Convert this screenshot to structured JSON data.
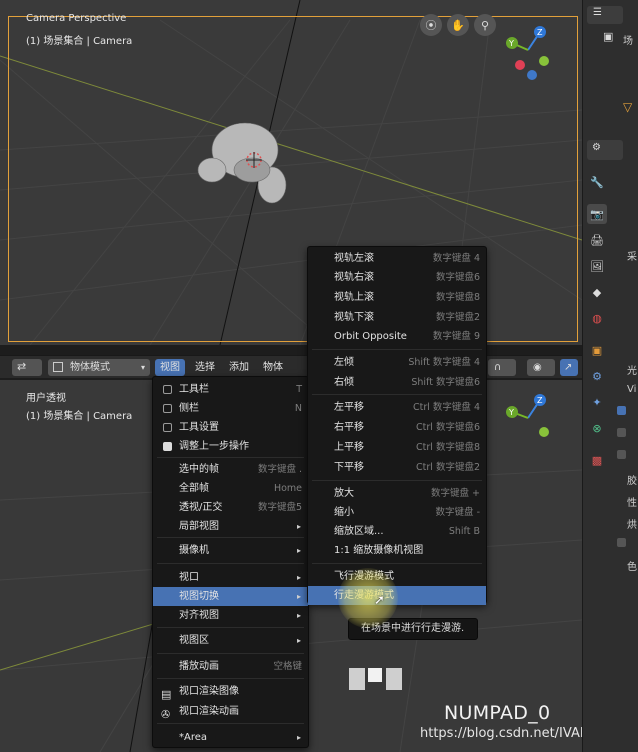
{
  "top_viewport": {
    "title": "Camera Perspective",
    "subtitle": "(1) 场景集合 | Camera",
    "gizmo": {
      "z": "Z",
      "y": "Y",
      "x": "X"
    }
  },
  "bottom_viewport": {
    "title": "用户透视",
    "subtitle": "(1) 场景集合 | Camera",
    "gizmo": {
      "z": "Z",
      "y": "Y"
    }
  },
  "header": {
    "mode": "物体模式",
    "menus": [
      "视图",
      "选择",
      "添加",
      "物体"
    ]
  },
  "view_menu": {
    "items": [
      {
        "label": "工具栏",
        "shortcut": "T",
        "type": "check",
        "checked": false
      },
      {
        "label": "侧栏",
        "shortcut": "N",
        "type": "check",
        "checked": false
      },
      {
        "label": "工具设置",
        "shortcut": "",
        "type": "check",
        "checked": false
      },
      {
        "label": "调整上一步操作",
        "shortcut": "",
        "type": "check",
        "checked": true
      },
      {
        "label": "选中的帧",
        "shortcut": "数字键盘 .",
        "type": "plain"
      },
      {
        "label": "全部帧",
        "shortcut": "Home",
        "type": "plain"
      },
      {
        "label": "透视/正交",
        "shortcut": "数字键盘5",
        "type": "plain"
      },
      {
        "label": "局部视图",
        "shortcut": "",
        "type": "submenu"
      },
      {
        "label": "摄像机",
        "shortcut": "",
        "type": "submenu"
      },
      {
        "label": "视口",
        "shortcut": "",
        "type": "submenu"
      },
      {
        "label": "视图切换",
        "shortcut": "",
        "type": "submenu",
        "highlighted": true
      },
      {
        "label": "对齐视图",
        "shortcut": "",
        "type": "submenu"
      },
      {
        "label": "视图区",
        "shortcut": "",
        "type": "submenu"
      },
      {
        "label": "播放动画",
        "shortcut": "空格键",
        "type": "plain"
      },
      {
        "label": "视口渲染图像",
        "shortcut": "",
        "type": "icon",
        "icon": "render-image-icon"
      },
      {
        "label": "视口渲染动画",
        "shortcut": "",
        "type": "icon",
        "icon": "render-animation-icon"
      },
      {
        "label": "*Area",
        "shortcut": "",
        "type": "submenu"
      }
    ]
  },
  "navigation_submenu": {
    "items": [
      {
        "label": "视轨左滚",
        "shortcut": "数字键盘 4"
      },
      {
        "label": "视轨右滚",
        "shortcut": "数字键盘6"
      },
      {
        "label": "视轨上滚",
        "shortcut": "数字键盘8"
      },
      {
        "label": "视轨下滚",
        "shortcut": "数字键盘2"
      },
      {
        "label": "Orbit Opposite",
        "shortcut": "数字键盘 9"
      },
      {
        "label": "左倾",
        "shortcut": "Shift 数字键盘 4"
      },
      {
        "label": "右倾",
        "shortcut": "Shift 数字键盘6"
      },
      {
        "label": "左平移",
        "shortcut": "Ctrl 数字键盘 4"
      },
      {
        "label": "右平移",
        "shortcut": "Ctrl 数字键盘6"
      },
      {
        "label": "上平移",
        "shortcut": "Ctrl 数字键盘8"
      },
      {
        "label": "下平移",
        "shortcut": "Ctrl 数字键盘2"
      },
      {
        "label": "放大",
        "shortcut": "数字键盘 +"
      },
      {
        "label": "缩小",
        "shortcut": "数字键盘 -"
      },
      {
        "label": "缩放区域...",
        "shortcut": "Shift B"
      },
      {
        "label": "1:1 缩放摄像机视图",
        "shortcut": ""
      },
      {
        "label": "飞行漫游模式",
        "shortcut": ""
      },
      {
        "label": "行走漫游模式",
        "shortcut": "",
        "highlighted": true
      }
    ]
  },
  "tooltip": "在场景中进行行走漫游.",
  "key_overlay": "NUMPAD_0",
  "watermark": "https://blog.csdn.net/IVANSKI",
  "right_panel": {
    "text_fragments": [
      "场",
      "采",
      "光",
      "Vi",
      "胶",
      "性",
      "烘",
      "色"
    ]
  },
  "colors": {
    "accent": "#4772b3",
    "camera_frame": "#e2a03a",
    "menu_bg": "#181818"
  }
}
